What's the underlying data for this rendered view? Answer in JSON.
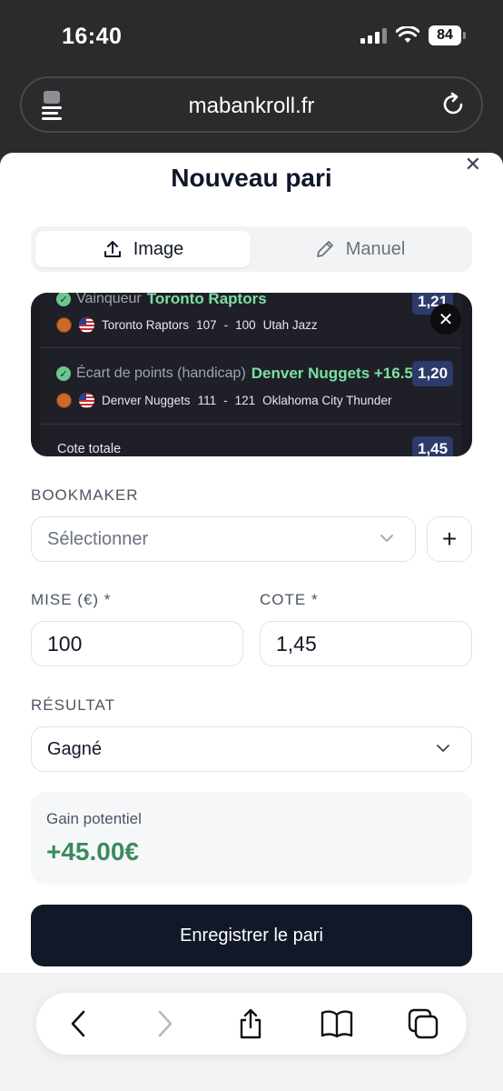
{
  "status_bar": {
    "time": "16:40",
    "battery": "84"
  },
  "browser": {
    "url": "mabankroll.fr"
  },
  "sheet": {
    "title": "Nouveau pari",
    "tabs": [
      {
        "label": "Image",
        "active": true,
        "icon": "upload-icon"
      },
      {
        "label": "Manuel",
        "active": false,
        "icon": "pencil-icon"
      }
    ],
    "preview": {
      "bets": [
        {
          "market": "Vainqueur",
          "pick": "Toronto Raptors",
          "odd": "1,21",
          "match": {
            "home": "Toronto Raptors",
            "score_home": "107",
            "sep": "-",
            "score_away": "100",
            "away": "Utah Jazz"
          }
        },
        {
          "market": "Écart de points (handicap)",
          "pick": "Denver Nuggets +16.5",
          "odd": "1,20",
          "match": {
            "home": "Denver Nuggets",
            "score_home": "111",
            "sep": "-",
            "score_away": "121",
            "away": "Oklahoma City Thunder"
          }
        }
      ],
      "total_label": "Cote totale",
      "total_odd": "1,45"
    },
    "bookmaker": {
      "label": "BOOKMAKER",
      "placeholder": "Sélectionner",
      "add_label": "+"
    },
    "stake": {
      "label": "MISE (€) *",
      "value": "100"
    },
    "odds": {
      "label": "COTE *",
      "value": "1,45"
    },
    "result": {
      "label": "RÉSULTAT",
      "value": "Gagné"
    },
    "gain": {
      "label": "Gain potentiel",
      "value": "+45.00€"
    },
    "submit_label": "Enregistrer le pari"
  },
  "colors": {
    "accent_dark": "#111827",
    "gain_green": "#3c8a5e",
    "pick_green": "#7be0a3"
  }
}
